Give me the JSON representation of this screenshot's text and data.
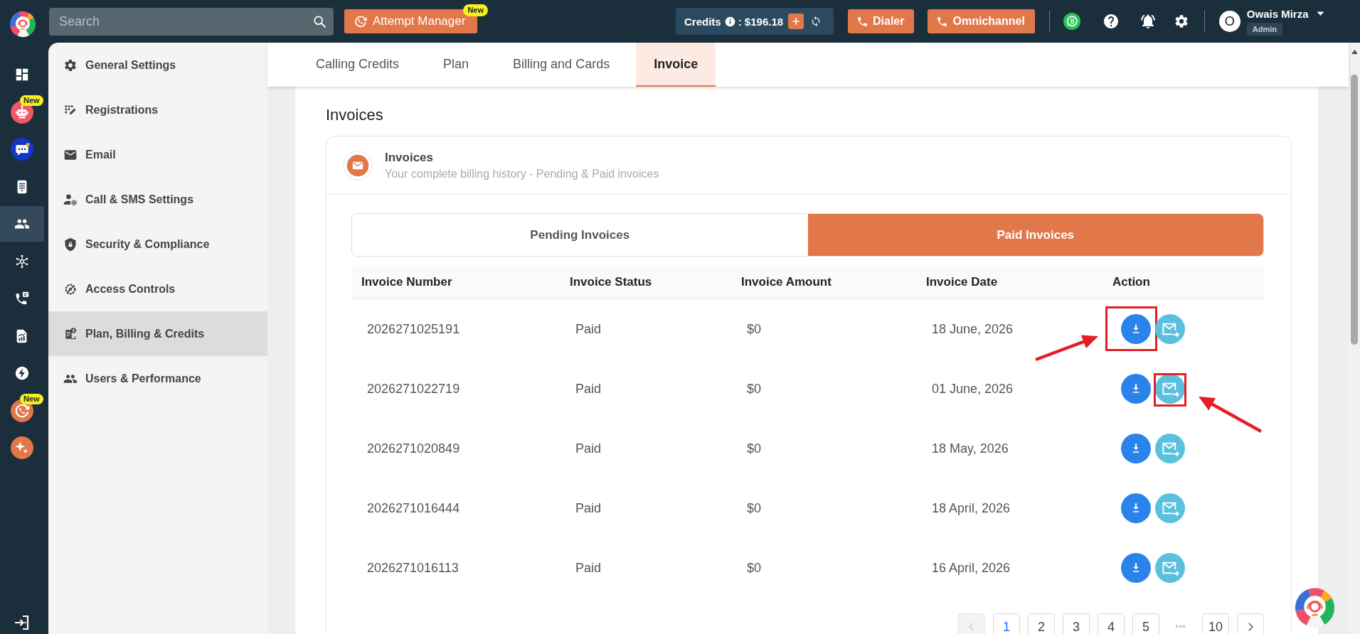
{
  "top_bar": {
    "search": {
      "placeholder": "Search"
    },
    "attempt_manager": {
      "label": "Attempt Manager",
      "badge": "New"
    },
    "credits": {
      "label": "Credits",
      "value": ": $196.18"
    },
    "buttons": [
      "Dialer",
      "Omnichannel"
    ],
    "user": {
      "initial": "O",
      "name": "Owais Mirza",
      "role": "Admin"
    }
  },
  "nav_rail": {
    "items": [
      {
        "selected": false
      },
      {
        "selected": false,
        "badge": "New"
      },
      {
        "selected": false
      },
      {
        "selected": false
      },
      {
        "selected": true
      },
      {
        "selected": false
      },
      {
        "selected": false
      },
      {
        "selected": false
      },
      {
        "selected": false
      },
      {
        "selected": false,
        "badge": "New"
      },
      {
        "selected": false
      }
    ]
  },
  "sidebar": {
    "items": [
      {
        "label": "General Settings",
        "selected": false
      },
      {
        "label": "Registrations",
        "selected": false
      },
      {
        "label": "Email",
        "selected": false
      },
      {
        "label": "Call & SMS Settings",
        "selected": false
      },
      {
        "label": "Security & Compliance",
        "selected": false
      },
      {
        "label": "Access Controls",
        "selected": false
      },
      {
        "label": "Plan, Billing & Credits",
        "selected": true
      },
      {
        "label": "Users & Performance",
        "selected": false
      }
    ]
  },
  "tabs": [
    {
      "label": "Calling Credits",
      "selected": false
    },
    {
      "label": "Plan",
      "selected": false
    },
    {
      "label": "Billing and Cards",
      "selected": false
    },
    {
      "label": "Invoice",
      "selected": true
    }
  ],
  "page_title": "Invoices",
  "invoices_card": {
    "title": "Invoices",
    "subtitle": "Your complete billing history - Pending & Paid invoices",
    "segments": [
      {
        "label": "Pending Invoices",
        "selected": false
      },
      {
        "label": "Paid Invoices",
        "selected": true
      }
    ],
    "table": {
      "columns": [
        "Invoice Number",
        "Invoice Status",
        "Invoice Amount",
        "Invoice Date",
        "Action"
      ],
      "rows": [
        {
          "number": "2026271025191",
          "status": "Paid",
          "amount": "$0",
          "date": "18 June, 2026",
          "download_marked": true,
          "email_marked": false
        },
        {
          "number": "2026271022719",
          "status": "Paid",
          "amount": "$0",
          "date": "01 June, 2026",
          "download_marked": false,
          "email_marked": true
        },
        {
          "number": "2026271020849",
          "status": "Paid",
          "amount": "$0",
          "date": "18 May, 2026",
          "download_marked": false,
          "email_marked": false
        },
        {
          "number": "2026271016444",
          "status": "Paid",
          "amount": "$0",
          "date": "18 April, 2026",
          "download_marked": false,
          "email_marked": false
        },
        {
          "number": "2026271016113",
          "status": "Paid",
          "amount": "$0",
          "date": "16 April, 2026",
          "download_marked": false,
          "email_marked": false
        }
      ]
    },
    "pagination": {
      "items": [
        {
          "kind": "prev",
          "disabled": true
        },
        {
          "kind": "page",
          "label": "1",
          "selected": true
        },
        {
          "kind": "page",
          "label": "2",
          "selected": false
        },
        {
          "kind": "page",
          "label": "3",
          "selected": false
        },
        {
          "kind": "page",
          "label": "4",
          "selected": false
        },
        {
          "kind": "page",
          "label": "5",
          "selected": false
        },
        {
          "kind": "ellipsis",
          "label": "•••"
        },
        {
          "kind": "page",
          "label": "10",
          "selected": false
        },
        {
          "kind": "next",
          "disabled": false
        }
      ]
    }
  }
}
